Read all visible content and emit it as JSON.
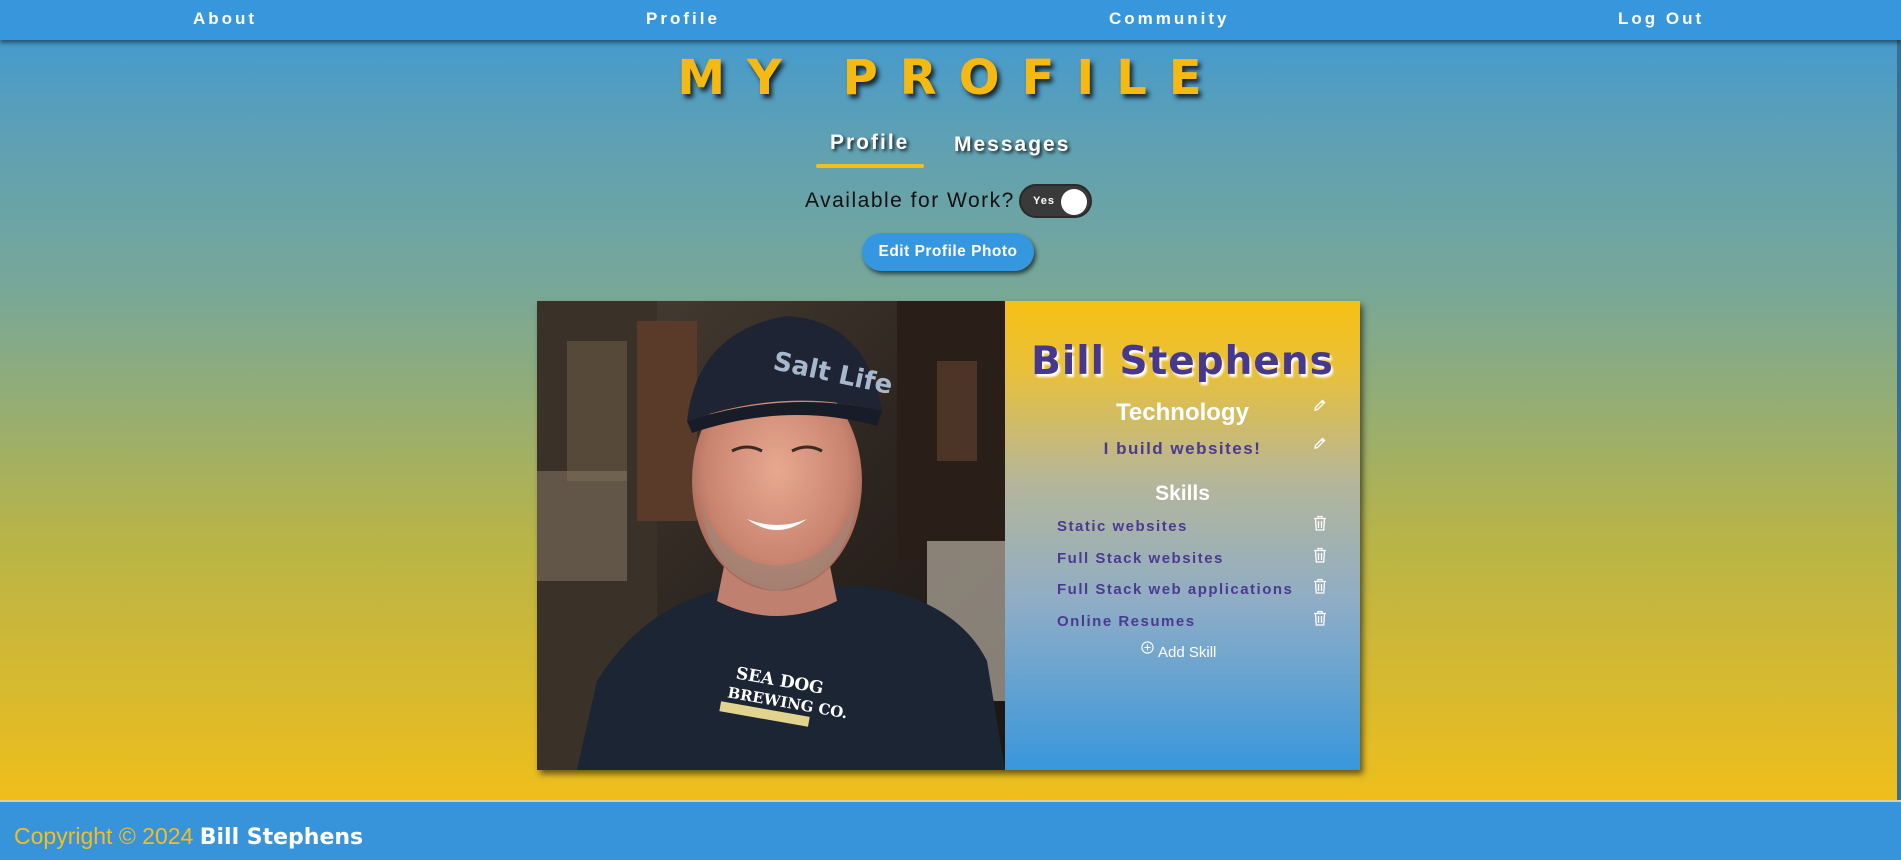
{
  "nav": {
    "items": [
      "About",
      "Profile",
      "Community",
      "Log Out"
    ]
  },
  "page": {
    "title": "MY PROFILE"
  },
  "tabs": {
    "profile": "Profile",
    "messages": "Messages",
    "active": "Profile"
  },
  "availability": {
    "label": "Available for Work?",
    "toggle_text": "Yes",
    "is_on": true
  },
  "edit_photo_label": "Edit Profile Photo",
  "profile": {
    "name": "Bill Stephens",
    "industry": "Technology",
    "tagline": "I build websites!",
    "photo_alt": "Profile photo of Bill Stephens"
  },
  "skills": {
    "title": "Skills",
    "items": [
      "Static websites",
      "Full Stack websites",
      "Full Stack web applications",
      "Online Resumes"
    ],
    "add_label": "Add Skill"
  },
  "footer": {
    "copyright": "Copyright © 2024",
    "name": "Bill Stephens"
  },
  "colors": {
    "nav": "#3897dc",
    "accent_gold": "#f6b912",
    "name_purple": "#46378f"
  }
}
